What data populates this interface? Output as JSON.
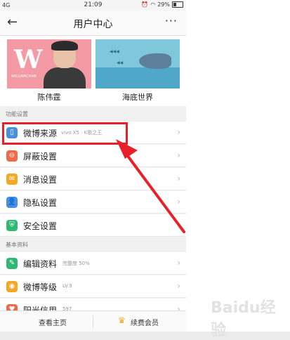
{
  "status": {
    "signal": "4G",
    "time": "21:09",
    "battery": "29%"
  },
  "nav": {
    "title": "用户中心"
  },
  "cards": [
    {
      "name": "陈伟霆",
      "logo_text": "W",
      "logo_sub": "WILLIAMCHAN"
    },
    {
      "name": "海底世界"
    }
  ],
  "sections": {
    "function": "功能设置",
    "basic": "基本资料"
  },
  "items_function": [
    {
      "label": "微博来源",
      "sub": "vivo X5 · K歌之王",
      "color": "#4a8fe0"
    },
    {
      "label": "屏蔽设置",
      "color": "#f06a4a"
    },
    {
      "label": "消息设置",
      "color": "#f5a623"
    },
    {
      "label": "隐私设置",
      "color": "#4a8fe0"
    },
    {
      "label": "安全设置",
      "color": "#2eb872"
    }
  ],
  "items_basic": [
    {
      "label": "编辑资料",
      "sub": "完整度 50%",
      "color": "#2eb872"
    },
    {
      "label": "微博等级",
      "sub": "LV.9",
      "color": "#f5a623"
    },
    {
      "label": "阳光信用",
      "sub": "597",
      "color": "#f06a4a"
    }
  ],
  "bottom": {
    "home": "查看主页",
    "vip": "续费会员"
  },
  "annotation": {
    "highlight_color": "#e8202a"
  },
  "watermark": "Baidu经验"
}
